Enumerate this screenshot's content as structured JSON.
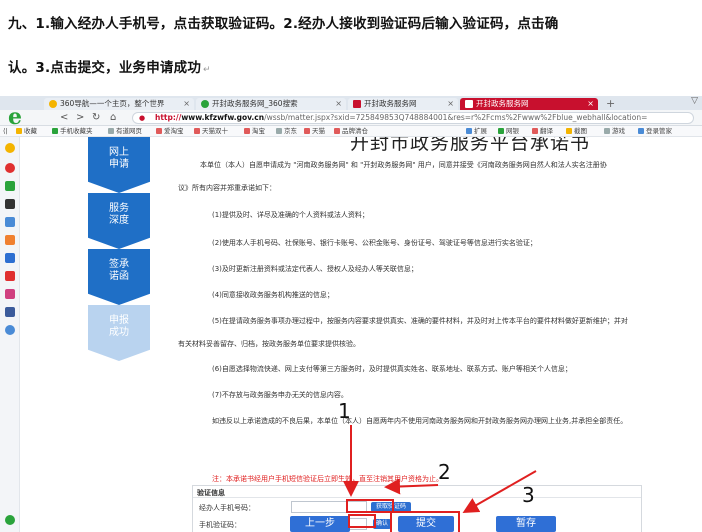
{
  "document": {
    "line1": "九、1.输入经办人手机号，点击获取验证码。2.经办人接收到验证码后输入验证码，点击确",
    "line2": "认。3.点击提交，业务申请成功",
    "line2_mark": "↵"
  },
  "browser": {
    "tabs": [
      {
        "label": "360导航—一个主页，整个世界"
      },
      {
        "label": "开封政务服务网_360搜索"
      },
      {
        "label": "开封政务服务网"
      },
      {
        "label": "开封政务服务网",
        "active": true
      }
    ],
    "url": {
      "protocol": "http://",
      "host": "www.kfzwfw.gov.cn",
      "path": "/wssb/matter.jspx?sxid=725849853Q748884001&res=r%2Fcms%2Fwww%2Fblue_webhall&location="
    },
    "bookmarks": [
      "收藏",
      "手机收藏夹",
      "有道网页",
      "爱淘宝",
      "天猫双十",
      "淘宝",
      "京东",
      "天猫",
      "品牌清仓"
    ],
    "bookmarks_right": [
      "扩展",
      "网银",
      "翻译",
      "截图",
      "游戏",
      "登录管家"
    ]
  },
  "page": {
    "title": "开封市政务服务平台承诺书",
    "steps": [
      {
        "line1": "网上",
        "line2": "申请",
        "status": "done"
      },
      {
        "line1": "服务",
        "line2": "深度",
        "status": "done"
      },
      {
        "line1": "签承",
        "line2": "诺函",
        "status": "done"
      },
      {
        "line1": "申报",
        "line2": "成功",
        "status": "pending"
      }
    ],
    "paragraphs": [
      "本单位（本人）自愿申请成为 \"河南政务服务网\" 和 \"开封政务服务网\" 用户，同意并接受《河南政务服务网自然人和法人实名注册协",
      "议》所有内容并郑重承诺如下：",
      "(1)提供及时、详尽及准确的个人资料或法人资料；",
      "(2)使用本人手机号码、社保账号、银行卡账号、公积金账号、身份证号、驾驶证号等信息进行实名验证；",
      "(3)及时更新注册资料或法定代表人、授权人及经办人等关联信息；",
      "(4)同意接收政务服务机构推送的信息；",
      "(5)在提请政务服务事项办理过程中，按服务内容要求提供真实、准确的要件材料，并及时对上传本平台的要件材料做好更新维护；并对",
      "有关材料妥善留存、归档，按政务服务单位要求提供核验。",
      "(6)自愿选择物流快递、网上支付等第三方服务时，及时提供真实姓名、联系地址、联系方式、账户等相关个人信息；",
      "(7)不存放与政务服务申办无关的信息内容。",
      "如违反以上承诺造成的不良后果，本单位（本人）自愿两年内不使用河南政务服务网和开封政务服务网办理网上业务,并承担全部责任。"
    ],
    "notice": "注：本承诺书经用户手机短信验证后立即生效，直至注销其用户资格为止。",
    "verify": {
      "title": "验证信息",
      "phone_label": "经办人手机号码：",
      "code_label": "手机验证码：",
      "get_code_button": "获取验证码",
      "confirm_button": "确认"
    },
    "buttons": {
      "prev": "上一步",
      "submit": "提交",
      "save": "暂存"
    }
  },
  "annotations": {
    "labels": [
      "1",
      "2",
      "3"
    ],
    "color": "#e02020"
  },
  "colors": {
    "step_active": "#1f6fc6",
    "step_pending": "#b9d3ef",
    "button_blue": "#2f6fd6",
    "active_tab": "#c8102e"
  }
}
